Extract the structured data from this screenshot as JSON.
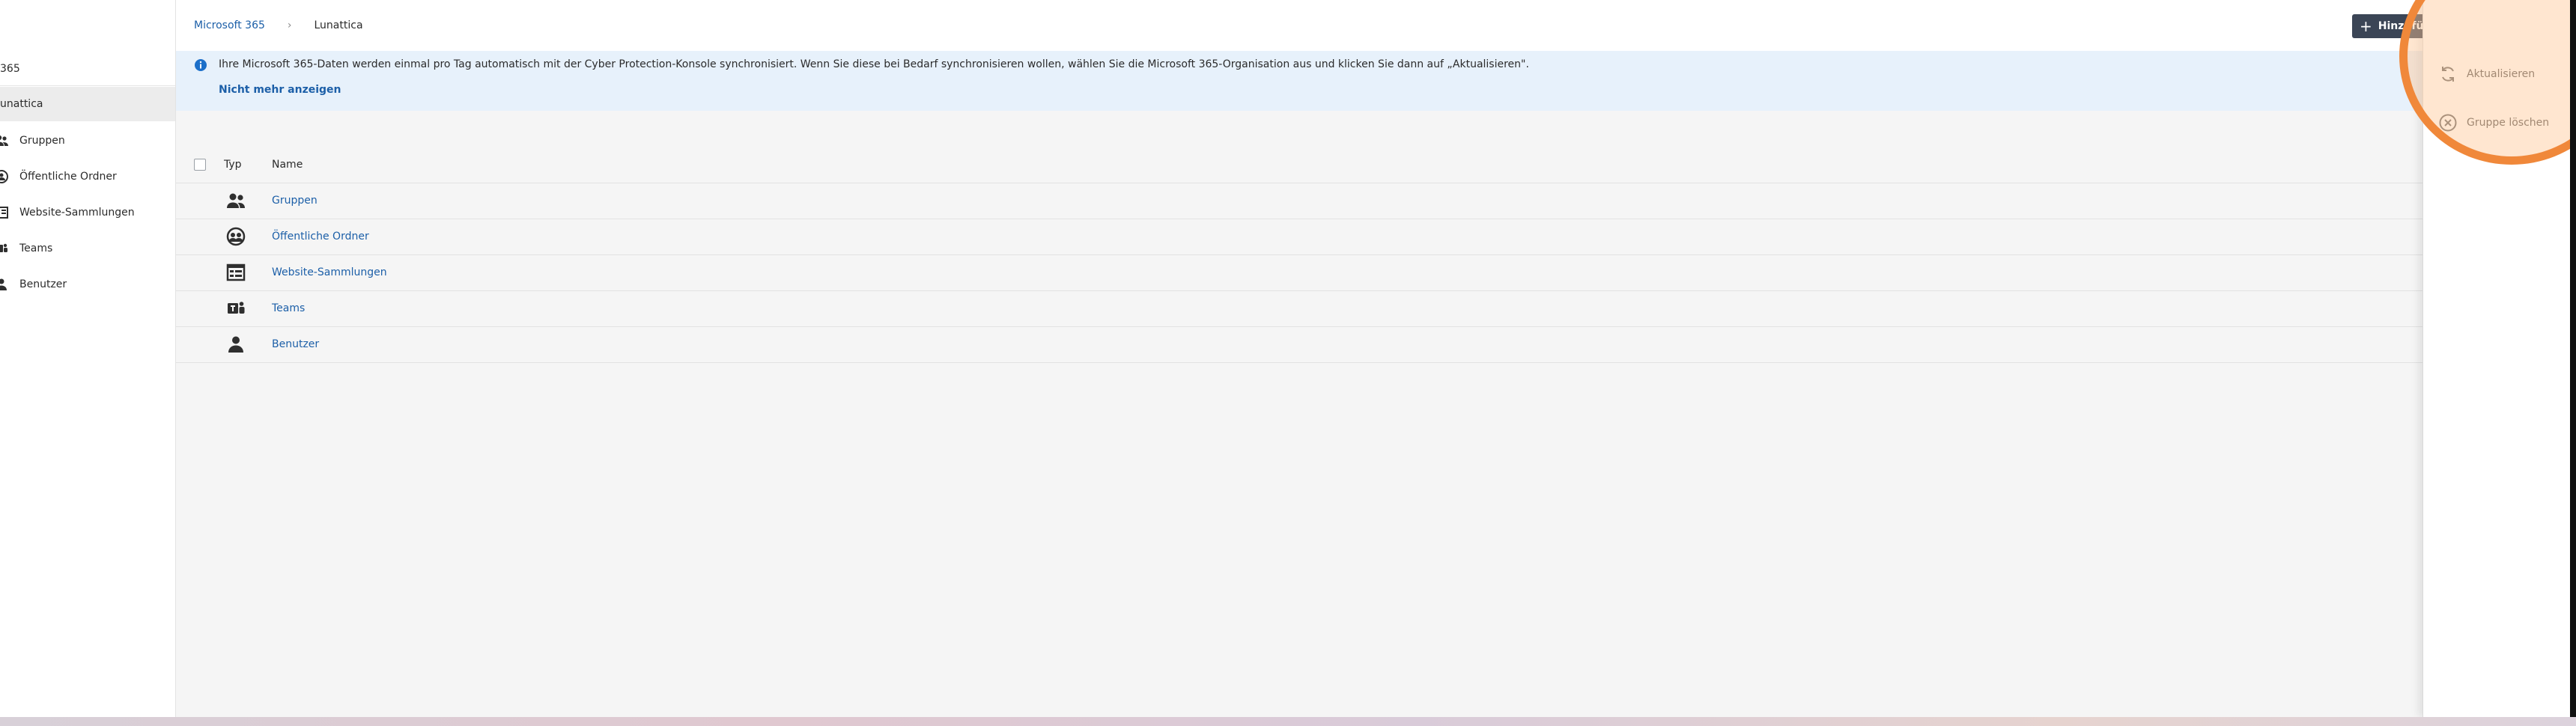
{
  "sidebar": {
    "top_label": "365",
    "org_label": "unattica",
    "items": [
      {
        "label": "Gruppen",
        "icon": "groups-icon"
      },
      {
        "label": "Öffentliche Ordner",
        "icon": "public-folders-icon"
      },
      {
        "label": "Website-Sammlungen",
        "icon": "site-collections-icon"
      },
      {
        "label": "Teams",
        "icon": "teams-icon"
      },
      {
        "label": "Benutzer",
        "icon": "user-icon"
      }
    ]
  },
  "header": {
    "breadcrumb_root": "Microsoft 365",
    "breadcrumb_separator": "›",
    "breadcrumb_current": "Lunattica",
    "add_button_label": "Hinzufügen"
  },
  "banner": {
    "text": "Ihre Microsoft 365-Daten werden einmal pro Tag automatisch mit der Cyber Protection-Konsole synchronisiert. Wenn Sie diese bei Bedarf synchronisieren wollen, wählen Sie die Microsoft 365-Organisation aus und klicken Sie dann auf „Aktualisieren\".",
    "dismiss_link": "Nicht mehr anzeigen",
    "close_symbol": "×"
  },
  "table": {
    "columns": [
      "Typ",
      "Name"
    ],
    "rows": [
      {
        "name": "Gruppen",
        "icon": "groups-icon"
      },
      {
        "name": "Öffentliche Ordner",
        "icon": "public-folders-icon"
      },
      {
        "name": "Website-Sammlungen",
        "icon": "site-collections-icon"
      },
      {
        "name": "Teams",
        "icon": "teams-icon"
      },
      {
        "name": "Benutzer",
        "icon": "user-icon"
      }
    ]
  },
  "right_panel": {
    "actions": [
      {
        "label": "Aktualisieren",
        "icon": "refresh-icon"
      },
      {
        "label": "Gruppe löschen",
        "icon": "delete-circle-icon"
      }
    ]
  },
  "colors": {
    "link": "#1c5fa8",
    "banner_bg": "#e7f1fb",
    "add_button_bg": "#3b4556",
    "highlight": "#f0883a"
  }
}
